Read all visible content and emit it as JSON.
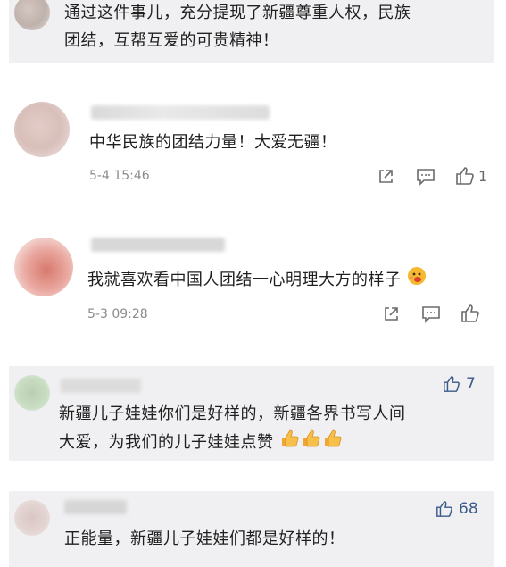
{
  "comments": [
    {
      "text_lines": [
        "通过这件事儿，充分提现了新疆尊重人权，民族",
        "团结，互帮互爱的可贵精神！"
      ]
    },
    {
      "text_lines": [
        "中华民族的团结力量！大爱无疆！"
      ],
      "time": "5-4 15:46",
      "like_count": "1"
    },
    {
      "text_lines": [
        "我就喜欢看中国人团结一心明理大方的样子"
      ],
      "emoji_icon": "thinking-face-emoji",
      "time": "5-3 09:28"
    },
    {
      "like_count": "7",
      "text_lines": [
        "新疆儿子娃娃你们是好样的，新疆各界书写人间",
        "大爱，为我们的儿子娃娃点赞"
      ],
      "emoji_icons": [
        "thumbs-up-emoji",
        "thumbs-up-emoji",
        "thumbs-up-emoji"
      ]
    },
    {
      "like_count": "68",
      "text_lines": [
        "正能量，新疆儿子娃娃们都是好样的！"
      ]
    }
  ],
  "icons": {
    "share": "share-icon",
    "reply": "comment-icon",
    "like": "thumbs-up-icon"
  },
  "colors": {
    "card_gray": "#f0f0f2",
    "text": "#1f1f1f",
    "meta": "#8a8a8a",
    "like_accent": "#3b5a8a"
  }
}
